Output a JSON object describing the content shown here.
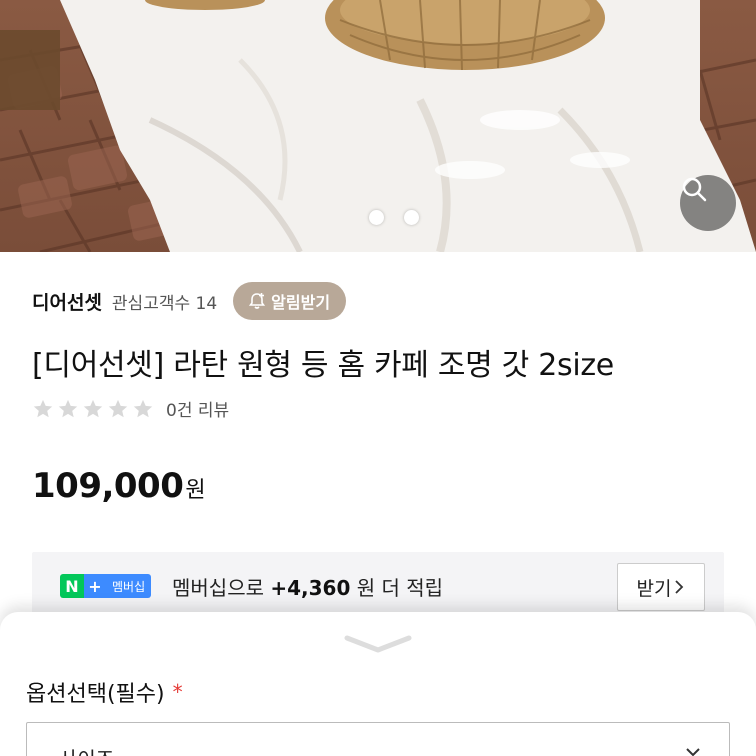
{
  "hero": {
    "image": "rattan-lamp-on-white-cloth-photo",
    "pager_dots": 2
  },
  "zoom": {
    "icon": "search-icon"
  },
  "shop": {
    "name": "디어선셋",
    "interest": "관심고객수 14",
    "notify_label": "알림받기",
    "notify_icon": "bell-plus-icon"
  },
  "product": {
    "title": "[디어선셋] 라탄 원형 등 홈 카페 조명 갓 2size"
  },
  "rating": {
    "stars": 0,
    "max": 5,
    "reviews": "0건 리뷰"
  },
  "price": {
    "amount": "109,000",
    "unit": "원"
  },
  "membership": {
    "badge_n": "N",
    "badge_plus": "+",
    "badge_label": "멤버십",
    "prefix": "멤버십으로",
    "amount": "+4,360",
    "suffix": "원 더 적립",
    "get_label": "받기",
    "accent_green": "#03c75a",
    "accent_blue": "#3d8bff"
  },
  "options": {
    "label": "옵션선택(필수)",
    "required_mark": "*",
    "select_text": "사이즈"
  }
}
